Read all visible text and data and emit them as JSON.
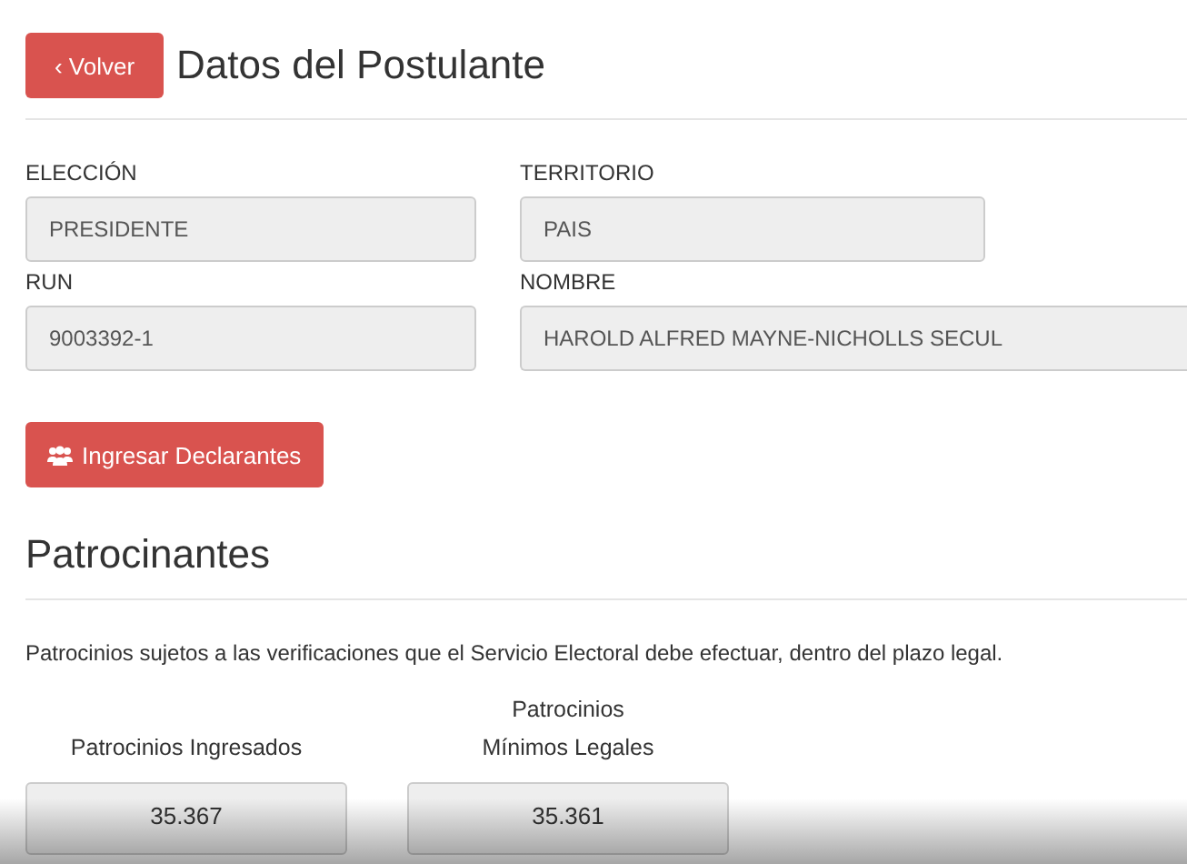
{
  "header": {
    "back_button": "‹ Volver",
    "title": "Datos del Postulante"
  },
  "fields": [
    {
      "label": "ELECCIÓN",
      "value": "PRESIDENTE"
    },
    {
      "label": "TERRITORIO",
      "value": "PAIS"
    },
    {
      "label": "RUN",
      "value": "9003392-1"
    },
    {
      "label": "NOMBRE",
      "value": "HAROLD ALFRED MAYNE-NICHOLLS SECUL"
    }
  ],
  "action_button": "Ingresar Declarantes",
  "section": {
    "title": "Patrocinantes",
    "note": "Patrocinios sujetos a las verificaciones que el Servicio Electoral debe efectuar, dentro del plazo legal."
  },
  "stats": [
    {
      "label_lines": [
        "Patrocinios Ingresados"
      ],
      "value": "35.367"
    },
    {
      "label_lines": [
        "Patrocinios",
        "Mínimos Legales"
      ],
      "value": "35.361"
    }
  ]
}
